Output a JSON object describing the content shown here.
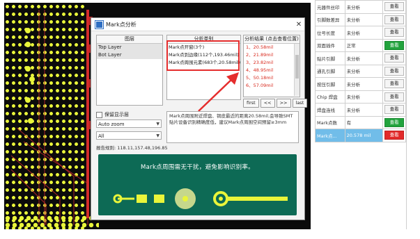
{
  "dialog": {
    "title": "Mark点分析",
    "close_label": "✕",
    "layers_header": "图层",
    "layers": [
      "Top Layer",
      "Bot Layer"
    ],
    "types_header": "分析类别",
    "types": [
      "Mark点开窗(3个)",
      "Mark点到边缘(112个,193.46mil)",
      "Mark点周围元素(683个,20.58mil)"
    ],
    "results_header": "分析结果 (点击查看位置)",
    "results": [
      "1、20.58mil",
      "2、21.89mil",
      "3、23.82mil",
      "4、48.95mil",
      "5、50.18mil",
      "6、57.09mil"
    ],
    "nav": [
      "first",
      "<<",
      ">>",
      "last"
    ],
    "checkbox_label": "保留显示层",
    "zoom_value": "Auto zoom",
    "filter_value": "All",
    "report": "报告规则: 118.11,157.48,196.85",
    "description": "Mark点周围附近焊盘、铜皮最近的距离20.58mil,会导致SMT贴片设备识别精确度低，建议Mark点周围空间预留≥3mm",
    "illustration_caption": "Mark点周围需无干扰，避免影响识别率。"
  },
  "table": {
    "rows": [
      {
        "name": "元器件丝印",
        "status": "未分析",
        "action": "查看",
        "style": "normal"
      },
      {
        "name": "引脚数差异",
        "status": "未分析",
        "action": "查看",
        "style": "normal"
      },
      {
        "name": "位号长度",
        "status": "未分析",
        "action": "查看",
        "style": "normal"
      },
      {
        "name": "双面插件",
        "status": "正常",
        "action": "查看",
        "style": "green"
      },
      {
        "name": "贴片引脚",
        "status": "未分析",
        "action": "查看",
        "style": "normal"
      },
      {
        "name": "通孔引脚",
        "status": "未分析",
        "action": "查看",
        "style": "normal"
      },
      {
        "name": "按压引脚",
        "status": "未分析",
        "action": "查看",
        "style": "normal"
      },
      {
        "name": "Chip 焊盘",
        "status": "未分析",
        "action": "查看",
        "style": "normal"
      },
      {
        "name": "焊盘连线",
        "status": "未分析",
        "action": "查看",
        "style": "normal"
      },
      {
        "name": "Mark点数",
        "status": "有",
        "action": "查看",
        "style": "green"
      },
      {
        "name": "Mark点...",
        "status": "20.578 mil",
        "action": "查看",
        "style": "red"
      }
    ]
  },
  "colors": {
    "pcb_background": "#0b0b0b",
    "pad_yellow": "#e9f53a",
    "highlight_red": "#e52d2d",
    "result_text": "#d8271b",
    "illustration_green": "#0d6a55",
    "button_green": "#22a33d",
    "button_red": "#e22a2a",
    "row_selected": "#71bde9"
  },
  "icons": [
    "dialog-app-icon",
    "close-icon",
    "dropdown-arrow-icon",
    "annotation-arrow-icon"
  ]
}
